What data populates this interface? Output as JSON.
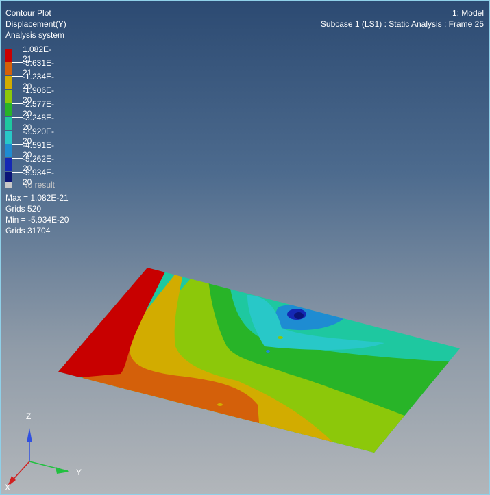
{
  "header": {
    "line1": "Contour Plot",
    "line2": "Displacement(Y)",
    "line3": "Analysis system",
    "model": "1: Model",
    "subcase": "Subcase 1 (LS1) : Static Analysis : Frame 25"
  },
  "legend": {
    "entries": [
      {
        "value": "1.082E-21",
        "color": "#c80000"
      },
      {
        "value": "-5.631E-21",
        "color": "#d4600a"
      },
      {
        "value": "-1.234E-20",
        "color": "#d2ac00"
      },
      {
        "value": "-1.906E-20",
        "color": "#8cc80a"
      },
      {
        "value": "-2.577E-20",
        "color": "#28b428"
      },
      {
        "value": "-3.248E-20",
        "color": "#1ec8a0"
      },
      {
        "value": "-3.920E-20",
        "color": "#28c8c8"
      },
      {
        "value": "-4.591E-20",
        "color": "#1e8cd2"
      },
      {
        "value": "-5.262E-20",
        "color": "#1428b4"
      },
      {
        "value": "-5.934E-20",
        "color": "#0a1478"
      }
    ],
    "no_result": "No result"
  },
  "stats": {
    "max": "Max = 1.082E-21",
    "max_grid": "Grids 520",
    "min": "Min = -5.934E-20",
    "min_grid": "Grids 31704"
  },
  "triad": {
    "z": "Z",
    "y": "Y",
    "x": "X"
  }
}
